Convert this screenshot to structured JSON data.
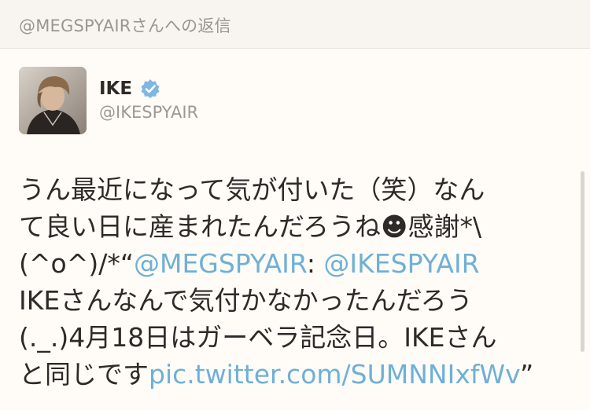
{
  "header": {
    "reply_label": "@MEGSPYAIRさんへの返信"
  },
  "author": {
    "name": "IKE",
    "handle": "@IKESPYAIR",
    "verified_icon": "verified-badge-icon",
    "avatar": "profile-photo"
  },
  "tweet": {
    "line1": "うん最近になって気が付いた（笑）なん",
    "line2_text": "て良い日に産まれたんだろうね",
    "line2_emoji": "☻",
    "line2_tail": "感謝*\\",
    "line3_pre": "(^o^)/*“",
    "mention1": "@MEGSPYAIR",
    "line3_colon": ": ",
    "mention2": "@IKESPYAIR",
    "line4": "IKEさんなんで気付かなかったんだろう",
    "line5": "(._.)4月18日はガーベラ記念日。IKEさん",
    "line6_pre": "と同じです",
    "pic_link": "pic.twitter.com/SUMNNIxfWv",
    "line6_close": "”"
  },
  "colors": {
    "link": "#6fb0d6",
    "verified": "#7fb7e3",
    "text": "#2d2a28",
    "muted": "#9c9893"
  }
}
